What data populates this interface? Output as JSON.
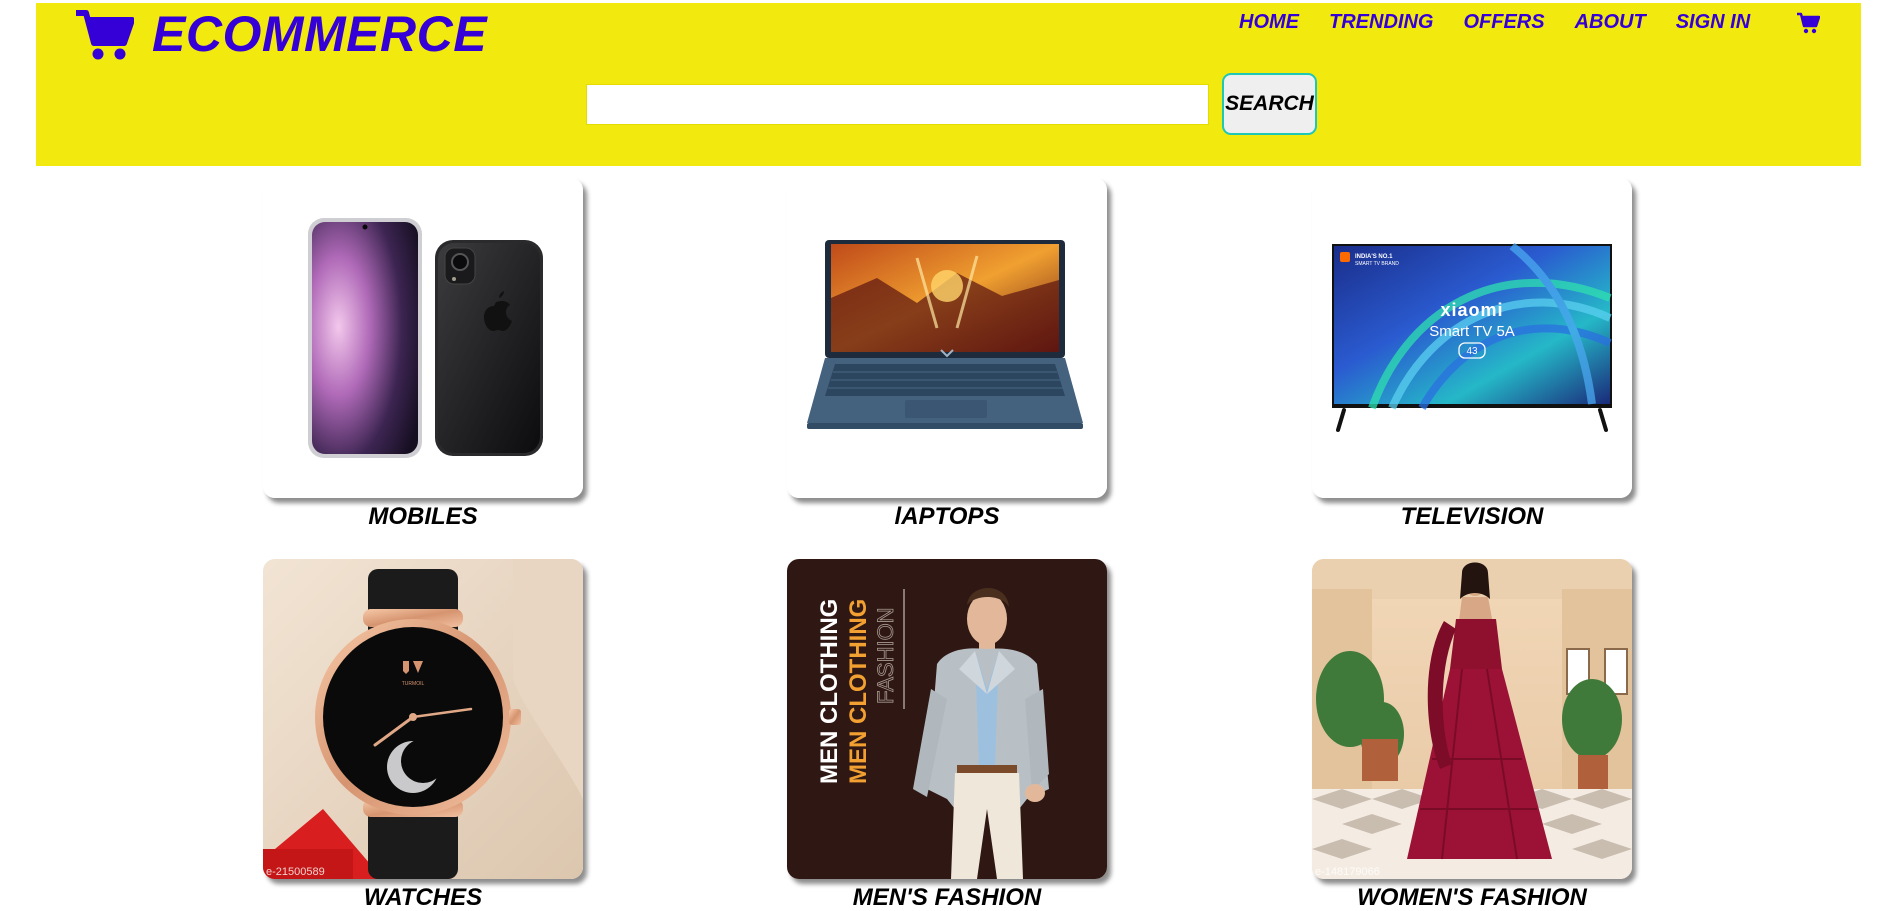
{
  "brand": {
    "name": "ECOMMERCE",
    "icon": "shopping-cart-icon",
    "color": "#3500d8"
  },
  "nav": {
    "items": [
      "HOME",
      "TRENDING",
      "OFFERS",
      "ABOUT",
      "SIGN IN"
    ],
    "cart_icon": "shopping-cart-icon"
  },
  "search": {
    "value": "",
    "placeholder": "",
    "button_label": "SEARCH"
  },
  "colors": {
    "header_bg": "#f2ea0e",
    "accent": "#3500d8",
    "search_border": "#1fc8b6"
  },
  "categories": [
    {
      "label": "MOBILES",
      "image": "smartphones-image"
    },
    {
      "label": "lAPTOPS",
      "image": "laptop-image"
    },
    {
      "label": "TELEVISION",
      "image": "television-image"
    },
    {
      "label": "WATCHES",
      "image": "wristwatch-image",
      "watermark": "e-21500589"
    },
    {
      "label": "MEN'S FASHION",
      "image": "men-clothing-image",
      "banner_lines": [
        "MEN CLOTHING",
        "MEN CLOTHING",
        "FASHION"
      ]
    },
    {
      "label": "WOMEN'S FASHION",
      "image": "women-dress-image",
      "watermark": "e-148179066"
    }
  ],
  "tv_screen": {
    "badge_line1": "INDIA'S NO.1",
    "badge_line2": "SMART TV BRAND",
    "brand": "xiaomi",
    "model": "Smart TV 5A",
    "size": "43"
  },
  "watch_brand": "TURMOIL"
}
